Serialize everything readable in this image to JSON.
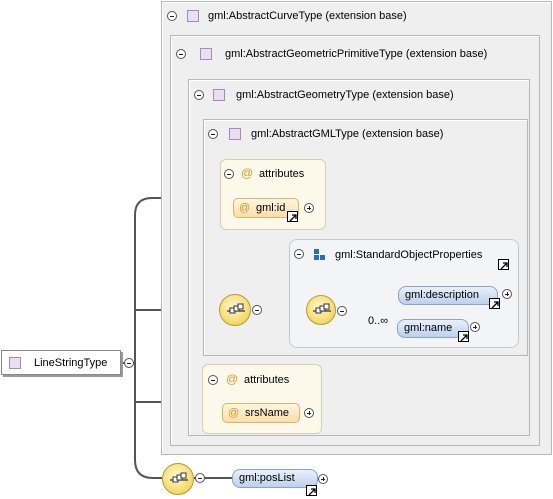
{
  "root": {
    "label": "LineStringType"
  },
  "bases": [
    {
      "label": "gml:AbstractCurveType (extension base)"
    },
    {
      "label": "gml:AbstractGeometricPrimitiveType (extension base)"
    },
    {
      "label": "gml:AbstractGeometryType (extension base)"
    },
    {
      "label": "gml:AbstractGMLType (extension base)"
    }
  ],
  "gml_attributes": {
    "title": "attributes",
    "at_symbol": "@",
    "items": [
      {
        "name": "gml:id"
      }
    ]
  },
  "standard_group": {
    "name": "gml:StandardObjectProperties"
  },
  "choice": {
    "cardinality": "0..∞",
    "elements": [
      {
        "name": "gml:description"
      },
      {
        "name": "gml:name"
      }
    ]
  },
  "own_attributes": {
    "title": "attributes",
    "at_symbol": "@",
    "items": [
      {
        "name": "srsName"
      }
    ]
  },
  "pos_list": {
    "name": "gml:posList"
  },
  "colors": {
    "type_icon": "#eadff0",
    "attribute_pill": "#f8deaa",
    "element_pill": "#bed0ea",
    "sequence": "#f3d866",
    "group_icon": "#2a6fb0"
  }
}
